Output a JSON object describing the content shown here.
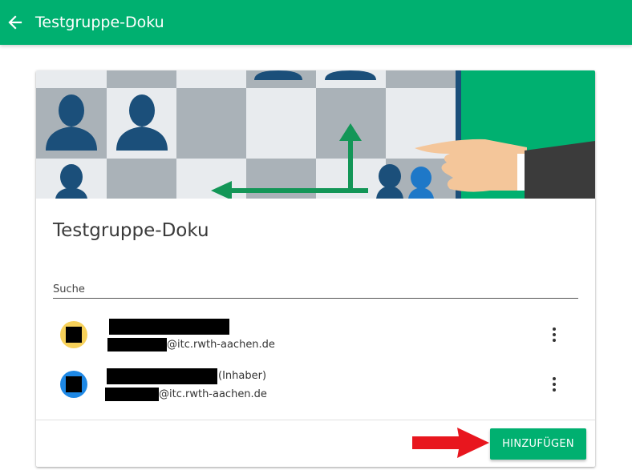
{
  "appbar": {
    "title": "Testgruppe-Doku",
    "color": "#00b070",
    "back_icon": "arrow-left-icon"
  },
  "card": {
    "title": "Testgruppe-Doku",
    "search": {
      "placeholder": "Suche",
      "value": ""
    },
    "members": [
      {
        "name_suffix": "",
        "email_domain": "@itc.rwth-aachen.de",
        "avatar_color": "#f7d15a"
      },
      {
        "name_suffix": "(Inhaber)",
        "email_domain": "@itc.rwth-aachen.de",
        "avatar_color": "#1e88e5"
      }
    ],
    "add_button": {
      "label": "HINZUFÜGEN"
    }
  },
  "colors": {
    "accent": "#00b070",
    "annotation_arrow": "#e8161e"
  }
}
